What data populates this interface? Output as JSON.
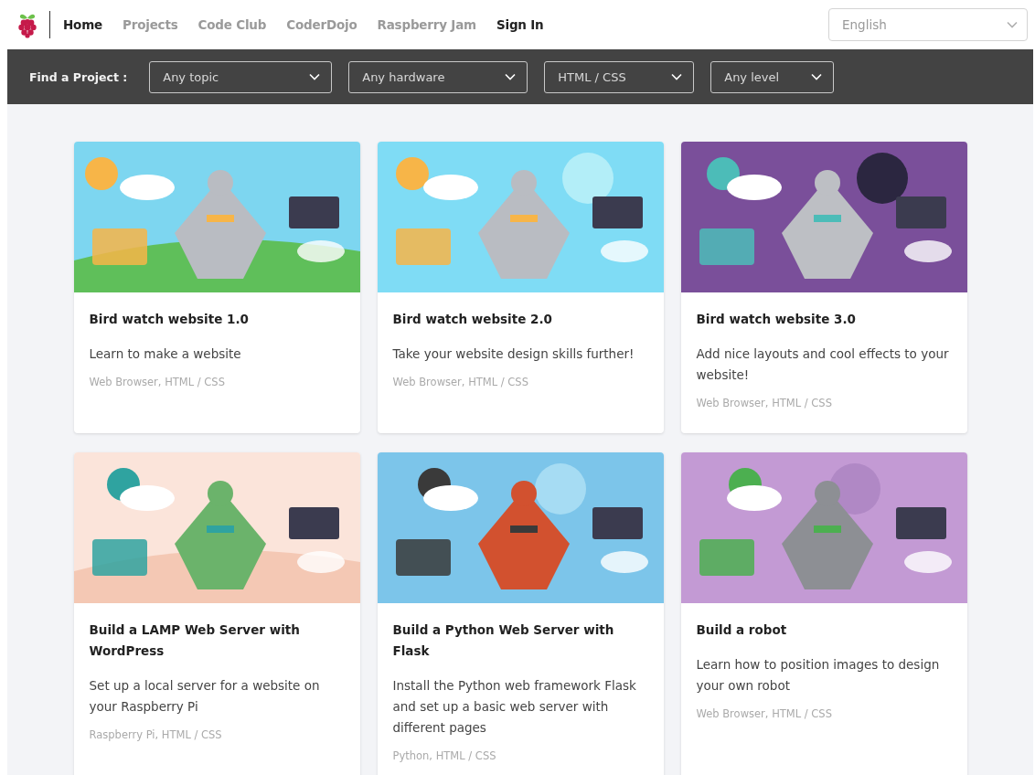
{
  "nav": {
    "items": [
      {
        "label": "Home",
        "selected": true
      },
      {
        "label": "Projects",
        "selected": false
      },
      {
        "label": "Code Club",
        "selected": false
      },
      {
        "label": "CoderDojo",
        "selected": false
      },
      {
        "label": "Raspberry Jam",
        "selected": false
      }
    ],
    "sign_in": "Sign In",
    "language": "English"
  },
  "filter_bar": {
    "label": "Find a Project :",
    "filters": [
      {
        "value": "Any topic"
      },
      {
        "value": "Any hardware"
      },
      {
        "value": "HTML / CSS"
      },
      {
        "value": "Any level"
      }
    ]
  },
  "projects": [
    {
      "kind": "picture",
      "title": "Bird watch website 1.0",
      "description": "Learn to make a website",
      "tags": "Web Browser, HTML / CSS"
    },
    {
      "kind": "picture",
      "title": "Bird watch website 2.0",
      "description": "Take your website design skills further!",
      "tags": "Web Browser, HTML / CSS"
    },
    {
      "kind": "picture",
      "title": "Bird watch website 3.0",
      "description": "Add nice layouts and cool effects to your website!",
      "tags": "Web Browser, HTML / CSS"
    },
    {
      "kind": "picture",
      "title": "Build a LAMP Web Server with WordPress",
      "description": "Set up a local server for a website on your Raspberry Pi",
      "tags": "Raspberry Pi, HTML / CSS"
    },
    {
      "kind": "picture",
      "title": "Build a Python Web Server with Flask",
      "description": "Install the Python web framework Flask and set up a basic web server with different pages",
      "tags": "Python, HTML / CSS"
    },
    {
      "kind": "picture",
      "title": "Build a robot",
      "description": "Learn how to position images to design your own robot",
      "tags": "Web Browser, HTML / CSS"
    }
  ]
}
